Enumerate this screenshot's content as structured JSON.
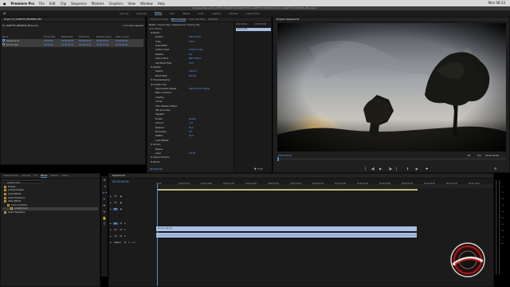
{
  "menubar": {
    "apple": "",
    "app_name": "Premiere Pro",
    "items": [
      "File",
      "Edit",
      "Clip",
      "Sequence",
      "Markers",
      "Graphics",
      "View",
      "Window",
      "Help"
    ],
    "clock": "Mon 08:33"
  },
  "titlebar": "/Volumes/Magnum/FA_DEFTE DESIGN/FILM/VIGNETTE/FA_VIGNETTE_PREMIERE_PRO/FA_VIGNETTE_PREMIERE_PRO.prproj *",
  "workspaces": [
    "Learning",
    "Assembly",
    "Editing",
    "Color",
    "Effects",
    "Audio",
    "Graphics",
    "Libraries",
    "Lumetri Color"
  ],
  "active_workspace": "Editing",
  "project": {
    "tab": "Project: FA_VIGNETTE_PREMIERE_PRO",
    "file": "FA_VIGNETTE_PREMIERE_PRO.prproj",
    "item_count": "2 of 2 items selected",
    "columns": [
      "Name",
      "Frame Rate",
      "Media Start",
      "Media End",
      "Media Duration",
      "Video In Point"
    ],
    "items": [
      {
        "name": "Sequence 01",
        "rate": "25,00 fps",
        "start": "00:00:00:00",
        "end": "00:00:24:24",
        "duration": "00:00:25:00",
        "in": "00:00:00:00"
      },
      {
        "name": "Source_Clip",
        "rate": "25,00 fps",
        "start": "00:00:00:00",
        "end": "00:00:24:24",
        "duration": "00:00:25:00",
        "in": "00:00:00:00"
      }
    ]
  },
  "effect_controls": {
    "tabs": [
      "Source: (no clips)",
      "Effect Controls",
      "Audio Clip Mixer",
      "Metadata"
    ],
    "header": "Master * Source_Clip > Sequence 01 * Source_Clip",
    "video_label": "Video Effects",
    "rows": [
      {
        "label": "fx  Motion",
        "value": ""
      },
      {
        "label": "Position",
        "value": "960,0    540,0"
      },
      {
        "label": "Scale",
        "value": "100,0"
      },
      {
        "label": "Scale Width",
        "value": ""
      },
      {
        "label": "Uniform Scale",
        "value": "Uniform Scale"
      },
      {
        "label": "Rotation",
        "value": "0,0"
      },
      {
        "label": "Anchor Point",
        "value": "960,0    540,0"
      },
      {
        "label": "Anti-flicker Filter",
        "value": "0,00"
      },
      {
        "label": "fx  Opacity",
        "value": ""
      },
      {
        "label": "Opacity",
        "value": "100,0 %"
      },
      {
        "label": "Blend Mode",
        "value": "Normal"
      },
      {
        "label": "fx  Time Remapping",
        "value": ""
      },
      {
        "label": "fx  Lumetri Color",
        "value": ""
      },
      {
        "label": "High Dynamic Range",
        "value": "High Dynamic Range"
      },
      {
        "label": "Basic Correction",
        "value": ""
      },
      {
        "label": "Creative",
        "value": ""
      },
      {
        "label": "Curves",
        "value": ""
      },
      {
        "label": "Color Wheels & Match",
        "value": ""
      },
      {
        "label": "HSL Secondary",
        "value": ""
      },
      {
        "label": "Vignette",
        "value": ""
      },
      {
        "label": "Enable",
        "value": "Enable"
      },
      {
        "label": "Amount",
        "value": "-3,0"
      },
      {
        "label": "Midpoint",
        "value": "50,0"
      },
      {
        "label": "Roundness",
        "value": "0,0"
      },
      {
        "label": "Feather",
        "value": "50,0"
      },
      {
        "label": "Audio Effects",
        "value": ""
      },
      {
        "label": "fx  Volume",
        "value": ""
      },
      {
        "label": "Bypass",
        "value": ""
      },
      {
        "label": "Level",
        "value": "0,0 dB"
      },
      {
        "label": "fx  Channel Volume",
        "value": ""
      },
      {
        "label": "fx  Panner",
        "value": ""
      }
    ],
    "mini_timeline": {
      "time1": "00:00:00:00",
      "time2": "00:00:05:00",
      "clip": "Source_Clip"
    },
    "timecode": "00:00:00:00"
  },
  "program": {
    "tab": "Program: Sequence 01",
    "timecode_left": "00:00:00:00",
    "fit": "Fit",
    "quality": "Full",
    "timecode_right": "00:00:25:00"
  },
  "bottom_left": {
    "tabs": [
      "Media Browser",
      "Libraries",
      "Info",
      "Effects",
      "Markers",
      "History"
    ],
    "search_placeholder": "Lumetri Color",
    "tree": [
      "Presets",
      "Lumetri Presets",
      "Audio Effects",
      "Audio Transitions",
      "Video Effects",
      "Color Correction",
      "Lumetri Color",
      "Video Transitions"
    ]
  },
  "timeline": {
    "tab": "Sequence 01",
    "timecode": "00:00:00:00",
    "ruler": [
      "00:00",
      "00:00:05:00",
      "00:00:10:00",
      "00:00:15:00",
      "00:00:20:00",
      "00:00:25:00",
      "00:00:30:00",
      "00:00:35:00",
      "00:00:40:00",
      "00:00:45:00",
      "00:00:50:00",
      "00:00:55:00",
      "00:01:00:00",
      "00:01:05:00",
      "00:01:10:00"
    ],
    "tracks_video": [
      "V3",
      "V2",
      "V1"
    ],
    "tracks_audio": [
      "A1",
      "A2",
      "A3"
    ],
    "master": "Master",
    "master_value": "0,0",
    "clip_v1": "Source_Clip [V]",
    "clip_a1": ""
  },
  "colors": {
    "accent": "#4a8bd4",
    "timecode": "#4da3ff",
    "clip_video": "#a7c1e4",
    "clip_audio": "#a7c1e4",
    "work_bar": "#c8bb7c"
  }
}
